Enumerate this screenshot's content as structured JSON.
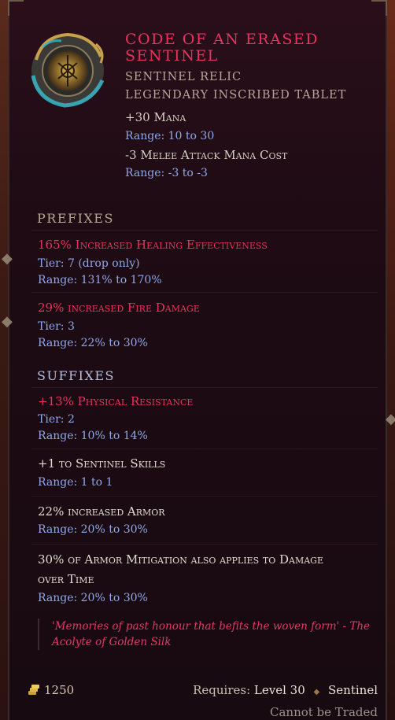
{
  "item": {
    "name": "Code of an Erased Sentinel",
    "base_type": "Sentinel Relic",
    "rarity_line": "Legendary Inscribed Tablet",
    "icon": "relic-tablet-icon"
  },
  "implicits": [
    {
      "value": "+30",
      "text": "Mana",
      "range": "Range: 10 to 30"
    },
    {
      "value": "-3",
      "text": "Melee Attack Mana Cost",
      "range": "Range: -3 to -3"
    }
  ],
  "prefixes": {
    "header": "Prefixes",
    "items": [
      {
        "text": "165% Increased Healing Effectiveness",
        "tier": "Tier: 7 (drop only)",
        "range": "Range: 131% to 170%"
      },
      {
        "text": "29% increased Fire Damage",
        "tier": "Tier: 3",
        "range": "Range: 22% to 30%"
      }
    ]
  },
  "suffixes": {
    "header": "Suffixes",
    "items": [
      {
        "text": "+13% Physical Resistance",
        "tier": "Tier: 2",
        "range": "Range: 10% to 14%"
      }
    ]
  },
  "extra_mods": [
    {
      "text": "+1 to Sentinel Skills",
      "range": "Range: 1 to 1"
    },
    {
      "text": "22% increased Armor",
      "range": "Range: 20% to 30%"
    },
    {
      "text_line1": "30% of Armor Mitigation also applies to Damage",
      "text_line2": "over Time",
      "range": "Range: 20% to 30%"
    }
  ],
  "lore": {
    "line1": "'Memories of past honour that befits the woven form' - The",
    "line2": "Acolyte of Golden Silk"
  },
  "footer": {
    "gold_icon": "gold-coins-icon",
    "gold_value": "1250",
    "requires_label": "Requires:",
    "level": "Level 30",
    "class": "Sentinel",
    "trade_status": "Cannot be Traded"
  },
  "colors": {
    "legendary": "#e8325f",
    "range_blue": "#8fa8ea",
    "panel_bg": "#1e0b14"
  }
}
